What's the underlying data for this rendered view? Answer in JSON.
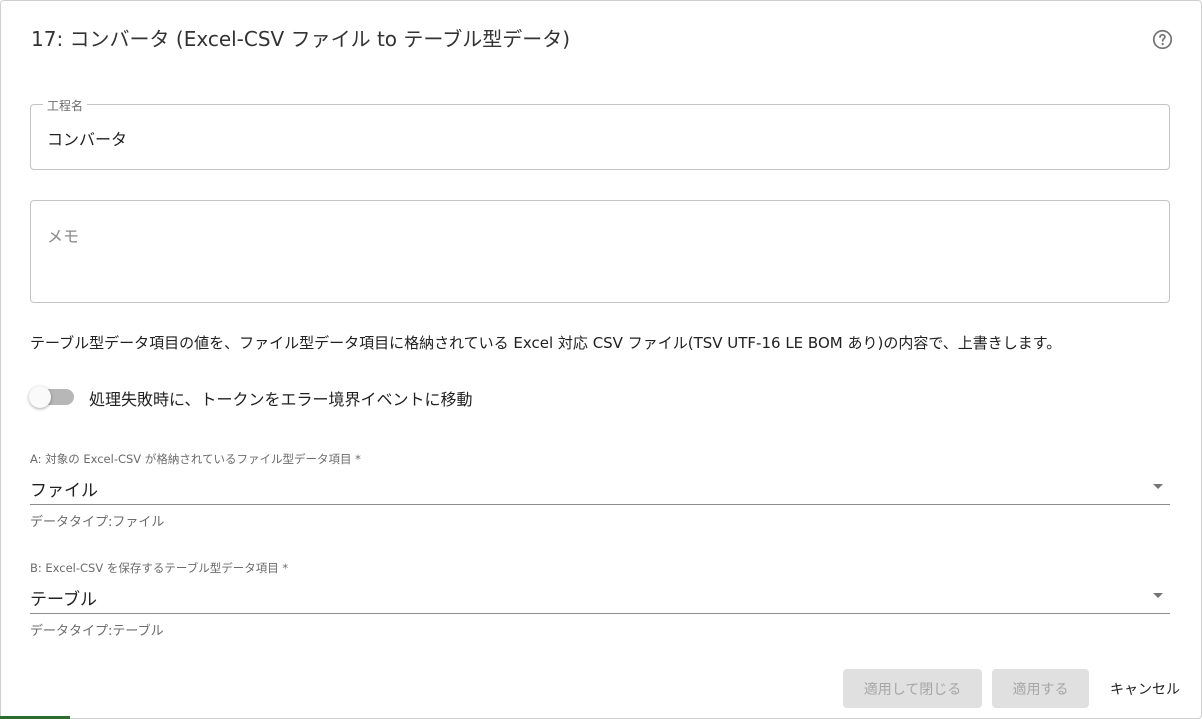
{
  "dialog": {
    "title": "17: コンバータ (Excel-CSV ファイル to テーブル型データ)",
    "help_icon": "help-circle-icon"
  },
  "name_field": {
    "label": "工程名",
    "value": "コンバータ"
  },
  "memo_field": {
    "placeholder": "メモ"
  },
  "description": "テーブル型データ項目の値を、ファイル型データ項目に格納されている Excel 対応 CSV ファイル(TSV UTF-16 LE BOM あり)の内容で、上書きします。",
  "toggle": {
    "label": "処理失敗時に、トークンをエラー境界イベントに移動",
    "checked": false
  },
  "select_a": {
    "label": "A: 対象の Excel-CSV が格納されているファイル型データ項目 *",
    "value": "ファイル",
    "helper": "データタイプ:ファイル"
  },
  "select_b": {
    "label": "B: Excel-CSV を保存するテーブル型データ項目 *",
    "value": "テーブル",
    "helper": "データタイプ:テーブル"
  },
  "actions": {
    "apply_close": "適用して閉じる",
    "apply": "適用する",
    "cancel": "キャンセル"
  },
  "colors": {
    "disabled_button_bg": "#e0e0e0",
    "disabled_button_text": "#a6a6a6",
    "toggle_track": "#b7b7b7"
  }
}
